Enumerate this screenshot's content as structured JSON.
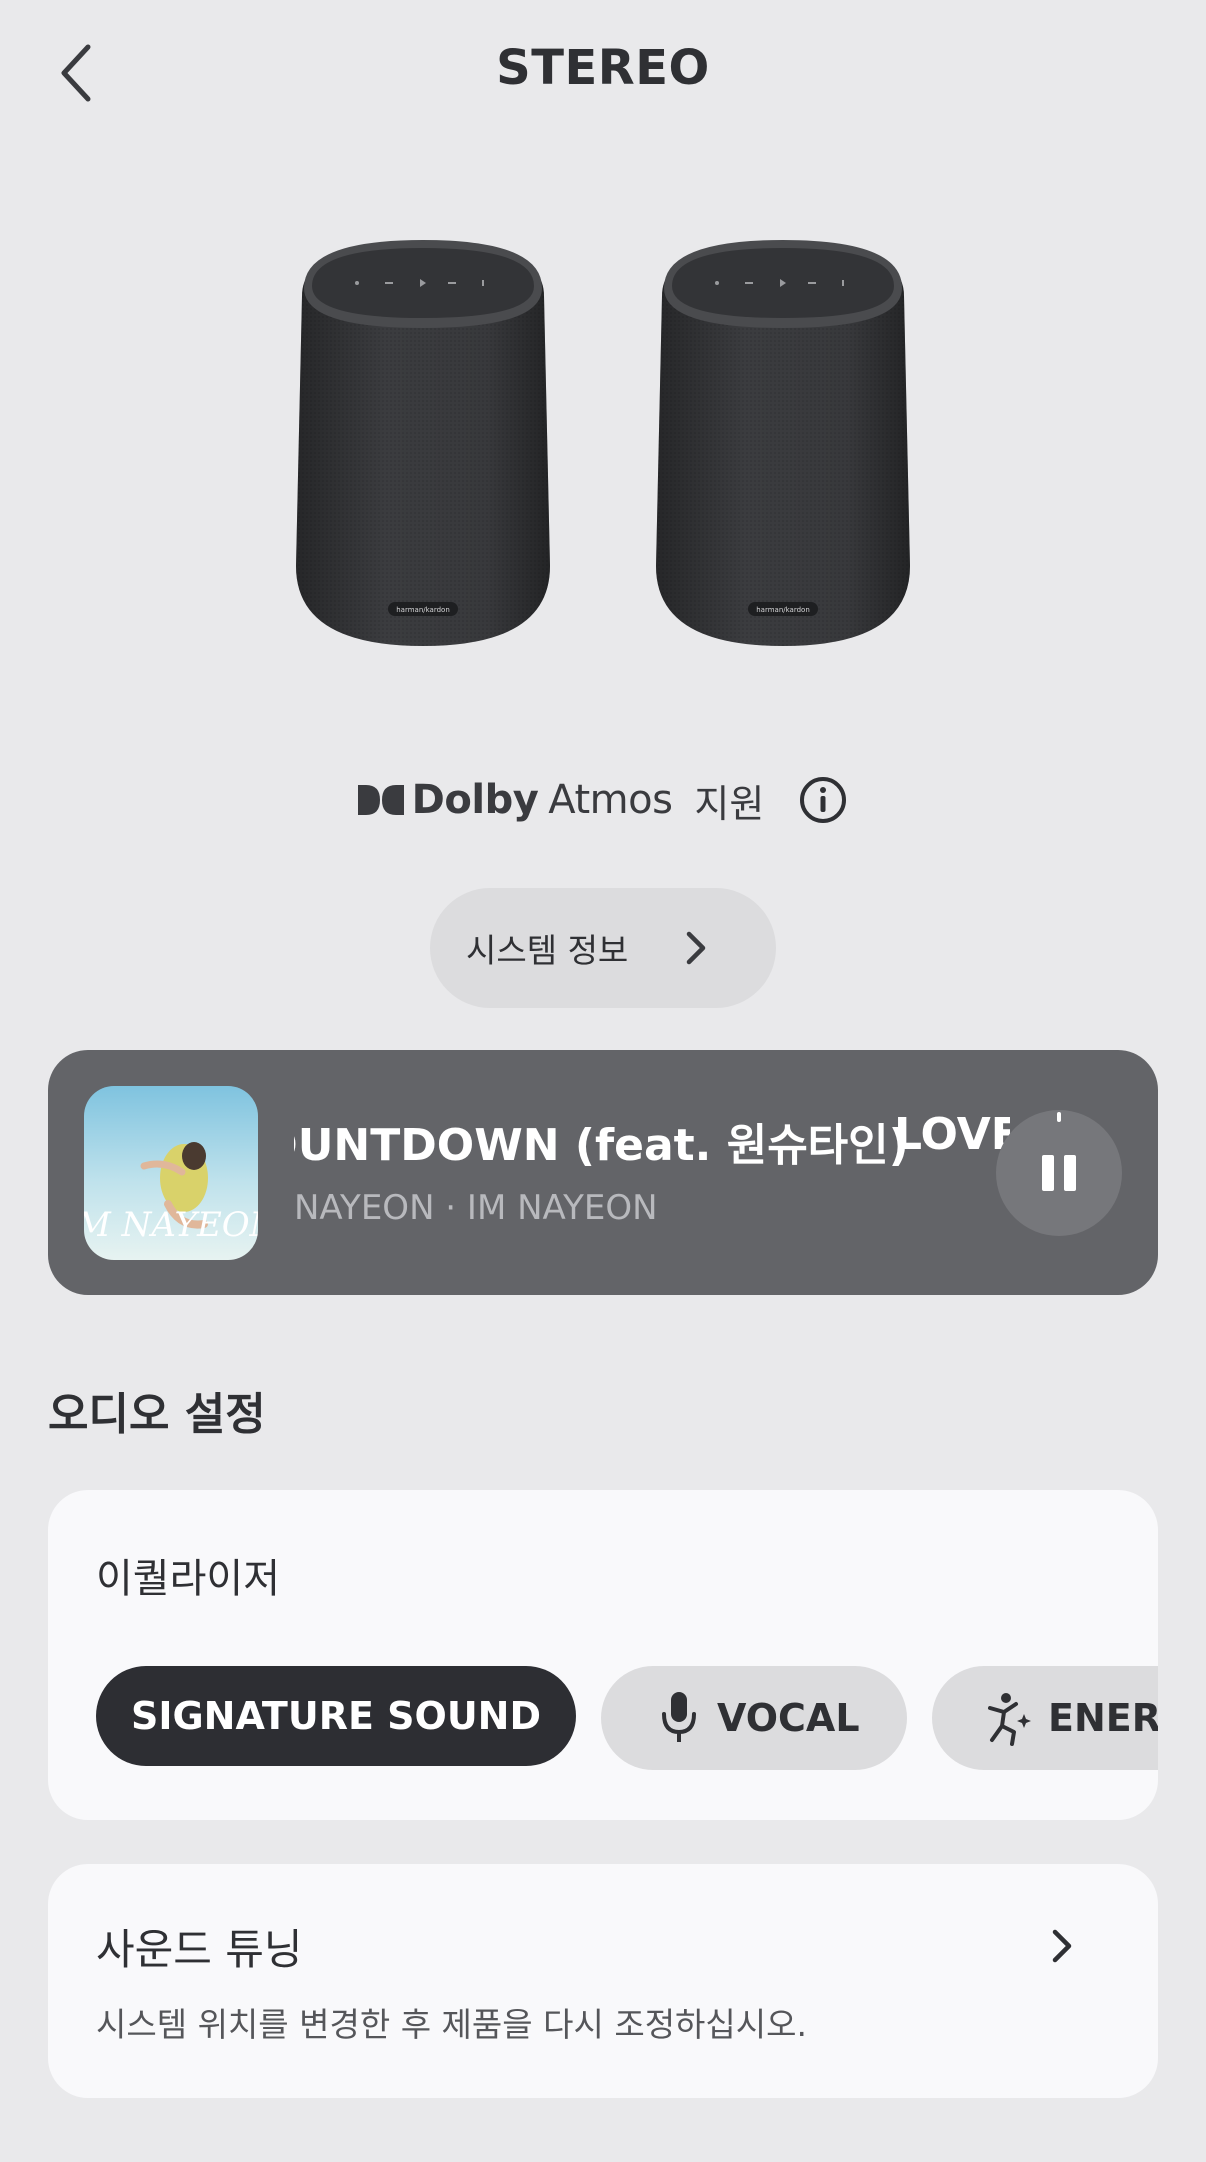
{
  "header": {
    "title": "STEREO",
    "back_icon": "chevron-left-icon"
  },
  "speakers": {
    "brand_label": "harman/kardon"
  },
  "dolby": {
    "brand": "Dolby",
    "product": "Atmos",
    "support_text": "지원",
    "info_icon": "info-circle-icon"
  },
  "system_info": {
    "label": "시스템 정보"
  },
  "now_playing": {
    "title": "COUNTDOWN (feat. 원슈타인)",
    "next_title_fragment": "LOVE",
    "artist_album": "NAYEON · IM NAYEON",
    "album_art_text": "IM NAYEON",
    "state_icon": "pause-icon"
  },
  "audio_settings": {
    "heading": "오디오 설정",
    "equalizer": {
      "label": "이퀄라이저",
      "presets": [
        {
          "label": "SIGNATURE SOUND",
          "selected": true,
          "icon": ""
        },
        {
          "label": "VOCAL",
          "selected": false,
          "icon": "microphone-icon"
        },
        {
          "label": "ENERGY",
          "selected": false,
          "icon": "dance-icon"
        }
      ]
    },
    "sound_tuning": {
      "title": "사운드 튜닝",
      "description": "시스템 위치를 변경한 후 제품을 다시 조정하십시오."
    }
  },
  "colors": {
    "background": "#e9e9eb",
    "player_bg": "#636468",
    "selected_chip": "#2d2e33",
    "chip": "#dcdcde",
    "card": "#f9f9fb"
  }
}
